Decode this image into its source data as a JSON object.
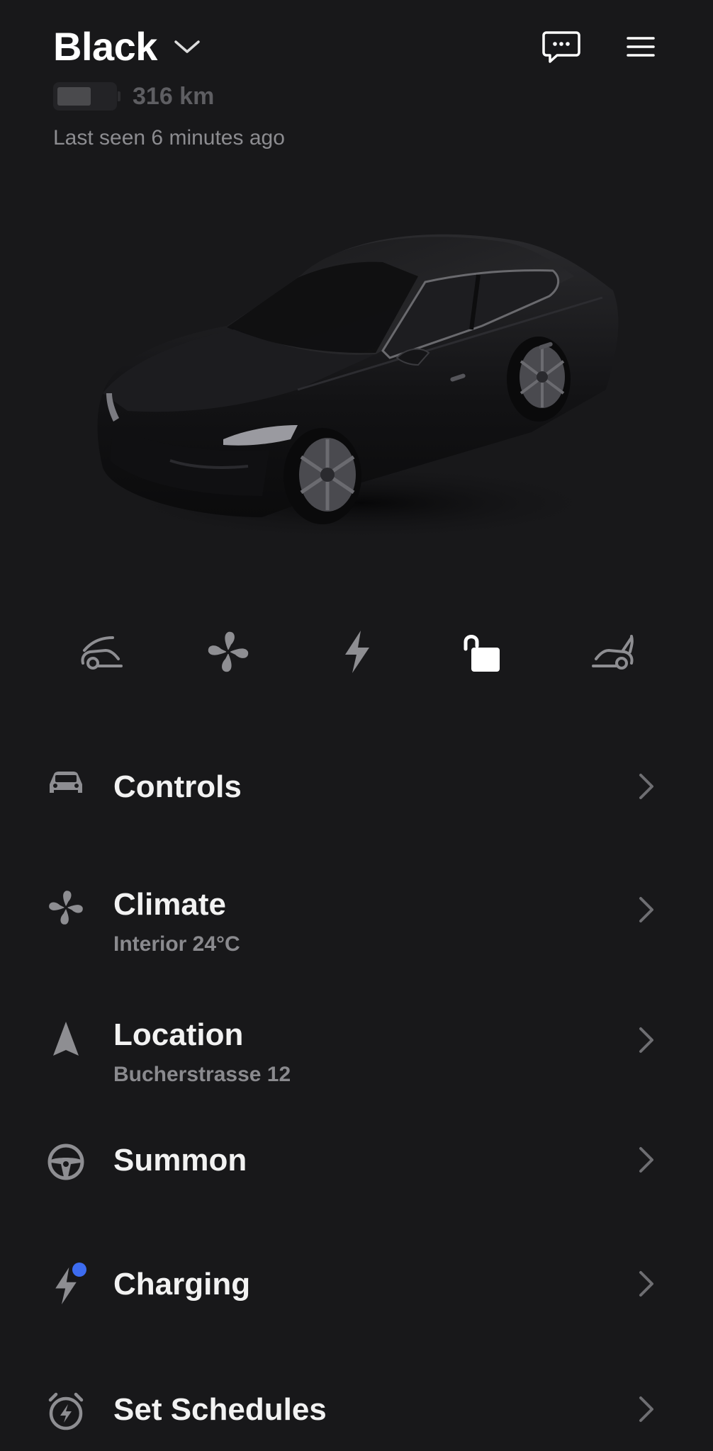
{
  "vehicle": {
    "name": "Black",
    "range": "316 km",
    "battery_level": 0.6,
    "last_seen": "Last seen 6 minutes ago"
  },
  "header_icons": [
    "chevron-down-icon",
    "chat-icon",
    "hamburger-menu-icon"
  ],
  "quick_actions": [
    {
      "name": "frunk-icon",
      "active": false
    },
    {
      "name": "fan-icon",
      "active": false
    },
    {
      "name": "lightning-icon",
      "active": false
    },
    {
      "name": "unlock-icon",
      "active": true
    },
    {
      "name": "trunk-icon",
      "active": false
    }
  ],
  "menu": {
    "controls": {
      "title": "Controls",
      "icon": "car-icon"
    },
    "climate": {
      "title": "Climate",
      "subtitle": "Interior 24°C",
      "icon": "fan-icon"
    },
    "location": {
      "title": "Location",
      "subtitle": "Bucherstrasse 12",
      "icon": "navigation-arrow-icon"
    },
    "summon": {
      "title": "Summon",
      "icon": "steering-wheel-icon"
    },
    "charging": {
      "title": "Charging",
      "icon": "lightning-icon",
      "badge": true
    },
    "schedules": {
      "title": "Set Schedules",
      "icon": "alarm-clock-icon"
    }
  },
  "colors": {
    "background": "#18181a",
    "text_primary": "#f2f2f2",
    "text_secondary": "#8a8a8e",
    "icon_inactive": "#8e8e92",
    "icon_active": "#ffffff",
    "badge": "#3d6cf0"
  }
}
